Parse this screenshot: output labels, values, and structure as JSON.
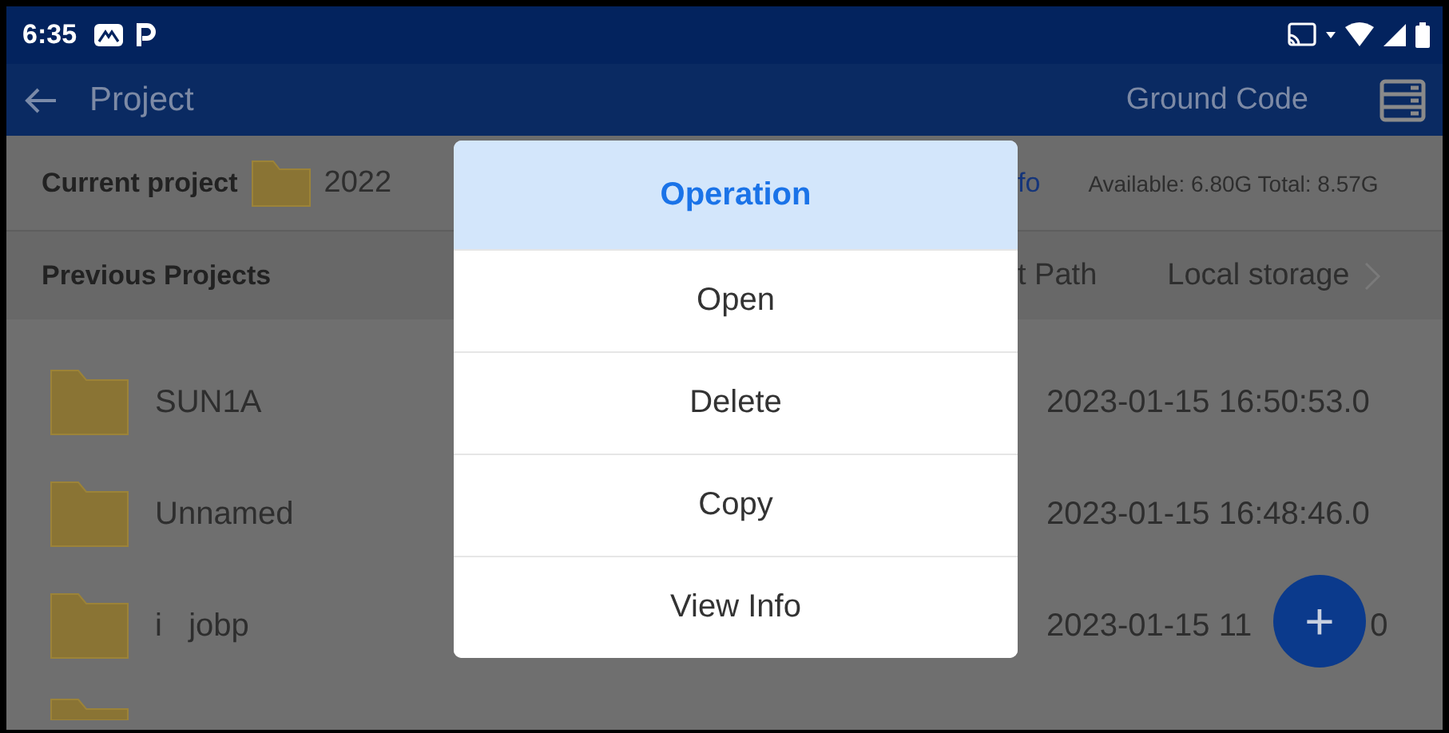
{
  "status_bar": {
    "time": "6:35"
  },
  "app_bar": {
    "title": "Project",
    "action": "Ground Code"
  },
  "current_project": {
    "label": "Current project",
    "name": "2022",
    "info_link": "fo",
    "storage": "Available: 6.80G Total: 8.57G"
  },
  "previous_projects": {
    "label": "Previous Projects",
    "path_label": "t Path",
    "storage_location": "Local storage"
  },
  "projects": [
    {
      "kind": "project",
      "name": "SUN1A",
      "date": "2023-01-15 16:50:53.0"
    },
    {
      "kind": "project",
      "name": "Unnamed",
      "date": "2023-01-15 16:48:46.0"
    },
    {
      "kind": "project",
      "name": "i   jobp",
      "date": "2023-01-15 11",
      "date_tail": "0"
    },
    {
      "kind": "partial"
    }
  ],
  "dialog": {
    "title": "Operation",
    "options": [
      "Open",
      "Delete",
      "Copy",
      "View Info"
    ]
  },
  "fab": {
    "label": "+"
  }
}
